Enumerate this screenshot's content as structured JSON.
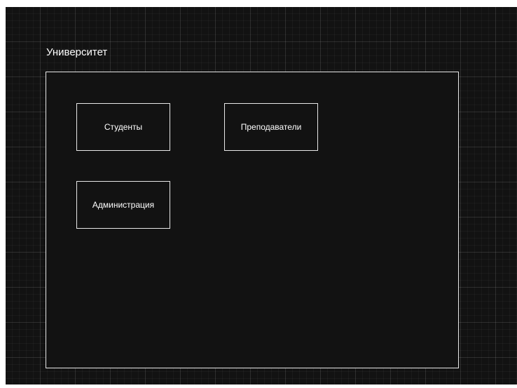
{
  "diagram": {
    "container": {
      "label": "Университет"
    },
    "nodes": [
      {
        "label": "Студенты"
      },
      {
        "label": "Преподаватели"
      },
      {
        "label": "Администрация"
      }
    ]
  }
}
